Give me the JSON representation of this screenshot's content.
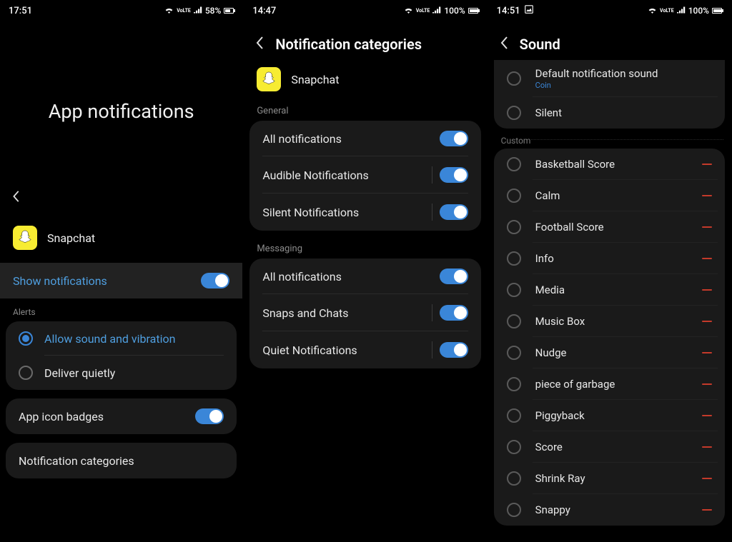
{
  "screen1": {
    "status": {
      "time": "17:51",
      "batt": "58%"
    },
    "title": "App notifications",
    "app_name": "Snapchat",
    "show_notifications": "Show notifications",
    "alerts_label": "Alerts",
    "allow_sound": "Allow sound and vibration",
    "deliver_quietly": "Deliver quietly",
    "app_icon_badges": "App icon badges",
    "notification_categories": "Notification categories"
  },
  "screen2": {
    "status": {
      "time": "14:47",
      "batt": "100%"
    },
    "title": "Notification categories",
    "app_name": "Snapchat",
    "general_label": "General",
    "general": {
      "all": "All notifications",
      "audible": "Audible Notifications",
      "silent": "Silent Notifications"
    },
    "messaging_label": "Messaging",
    "messaging": {
      "all": "All notifications",
      "snaps": "Snaps and Chats",
      "quiet": "Quiet Notifications"
    }
  },
  "screen3": {
    "status": {
      "time": "14:51",
      "batt": "100%"
    },
    "title": "Sound",
    "default_sound": "Default notification sound",
    "default_sub": "Coin",
    "silent": "Silent",
    "custom_label": "Custom",
    "custom": [
      "Basketball Score",
      "Calm",
      "Football Score",
      "Info",
      "Media",
      "Music Box",
      "Nudge",
      "piece of garbage",
      "Piggyback",
      "Score",
      "Shrink Ray",
      "Snappy"
    ]
  }
}
